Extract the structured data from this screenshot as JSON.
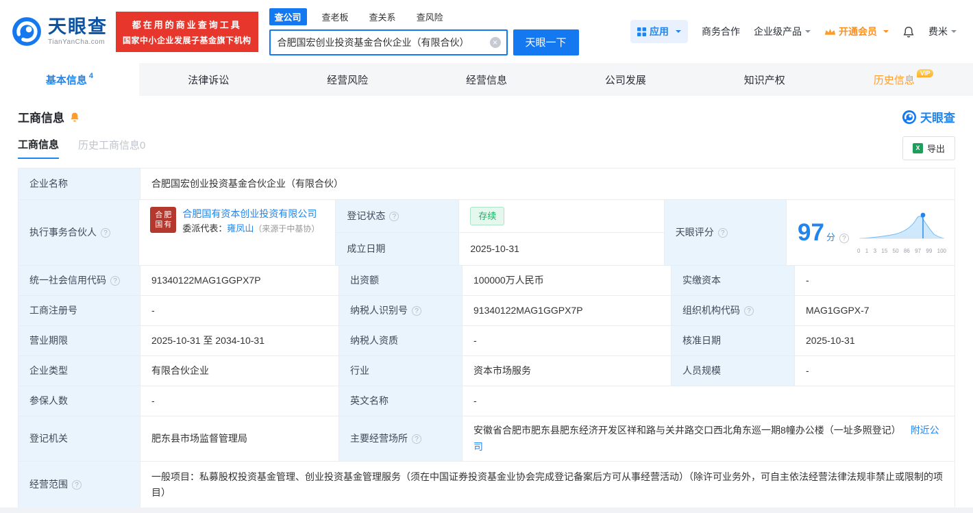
{
  "icons": {
    "help": "?",
    "clear": "×",
    "excel": "X"
  },
  "header": {
    "logo": {
      "brand": "天眼查",
      "domain": "TianYanCha.com"
    },
    "slogan": {
      "line1": "都在用的商业查询工具",
      "line2": "国家中小企业发展子基金旗下机构"
    },
    "search": {
      "tabs": [
        {
          "label": "查公司"
        },
        {
          "label": "查老板"
        },
        {
          "label": "查关系"
        },
        {
          "label": "查风险"
        }
      ],
      "value": "合肥国宏创业投资基金合伙企业（有限合伙）",
      "button_label": "天眼一下"
    },
    "nav": {
      "apps": "应用",
      "cooperation": "商务合作",
      "enterprise": "企业级产品",
      "vip": "开通会员",
      "user": "费米"
    }
  },
  "nav_tabs": [
    {
      "label": "基本信息",
      "count": "4"
    },
    {
      "label": "法律诉讼"
    },
    {
      "label": "经营风险"
    },
    {
      "label": "经营信息"
    },
    {
      "label": "公司发展"
    },
    {
      "label": "知识产权"
    },
    {
      "label": "历史信息",
      "badge": "VIP"
    }
  ],
  "section": {
    "title": "工商信息",
    "brand": "天眼查",
    "subtab_active": "工商信息",
    "subtab_history": "历史工商信息0",
    "export_label": "导出"
  },
  "info": {
    "company_name": {
      "label": "企业名称",
      "value": "合肥国宏创业投资基金合伙企业（有限合伙）"
    },
    "partner": {
      "label": "执行事务合伙人",
      "logo_text": "合肥国有",
      "company": "合肥国有资本创业投资有限公司",
      "rep_label": "委派代表：",
      "rep_name": "雍凤山",
      "rep_source": "（来源于中基协）"
    },
    "reg_status": {
      "label": "登记状态",
      "value": "存续"
    },
    "establish_date": {
      "label": "成立日期",
      "value": "2025-10-31"
    },
    "score": {
      "label": "天眼评分",
      "value": "97",
      "unit": "分",
      "axis": [
        "0",
        "1",
        "3",
        "15",
        "50",
        "86",
        "97",
        "99",
        "100"
      ]
    },
    "credit_code": {
      "label": "统一社会信用代码",
      "value": "91340122MAG1GGPX7P"
    },
    "capital": {
      "label": "出资额",
      "value": "100000万人民币"
    },
    "paid_capital": {
      "label": "实缴资本",
      "value": "-"
    },
    "reg_number": {
      "label": "工商注册号",
      "value": "-"
    },
    "taxpayer_id": {
      "label": "纳税人识别号",
      "value": "91340122MAG1GGPX7P"
    },
    "org_code": {
      "label": "组织机构代码",
      "value": "MAG1GGPX-7"
    },
    "business_term": {
      "label": "营业期限",
      "value": "2025-10-31 至 2034-10-31"
    },
    "taxpayer_quality": {
      "label": "纳税人资质",
      "value": "-"
    },
    "approve_date": {
      "label": "核准日期",
      "value": "2025-10-31"
    },
    "company_type": {
      "label": "企业类型",
      "value": "有限合伙企业"
    },
    "industry": {
      "label": "行业",
      "value": "资本市场服务"
    },
    "staff_size": {
      "label": "人员规模",
      "value": "-"
    },
    "insured_count": {
      "label": "参保人数",
      "value": "-"
    },
    "english_name": {
      "label": "英文名称",
      "value": "-"
    },
    "reg_authority": {
      "label": "登记机关",
      "value": "肥东县市场监督管理局"
    },
    "premises": {
      "label": "主要经营场所",
      "value": "安徽省合肥市肥东县肥东经济开发区祥和路与关井路交口西北角东巡一期8幢办公楼（一址多照登记）",
      "link": "附近公司"
    },
    "business_scope": {
      "label": "经营范围",
      "value": "一般项目：私募股权投资基金管理、创业投资基金管理服务（须在中国证券投资基金业协会完成登记备案后方可从事经营活动）（除许可业务外，可自主依法经营法律法规非禁止或限制的项目）"
    }
  }
}
